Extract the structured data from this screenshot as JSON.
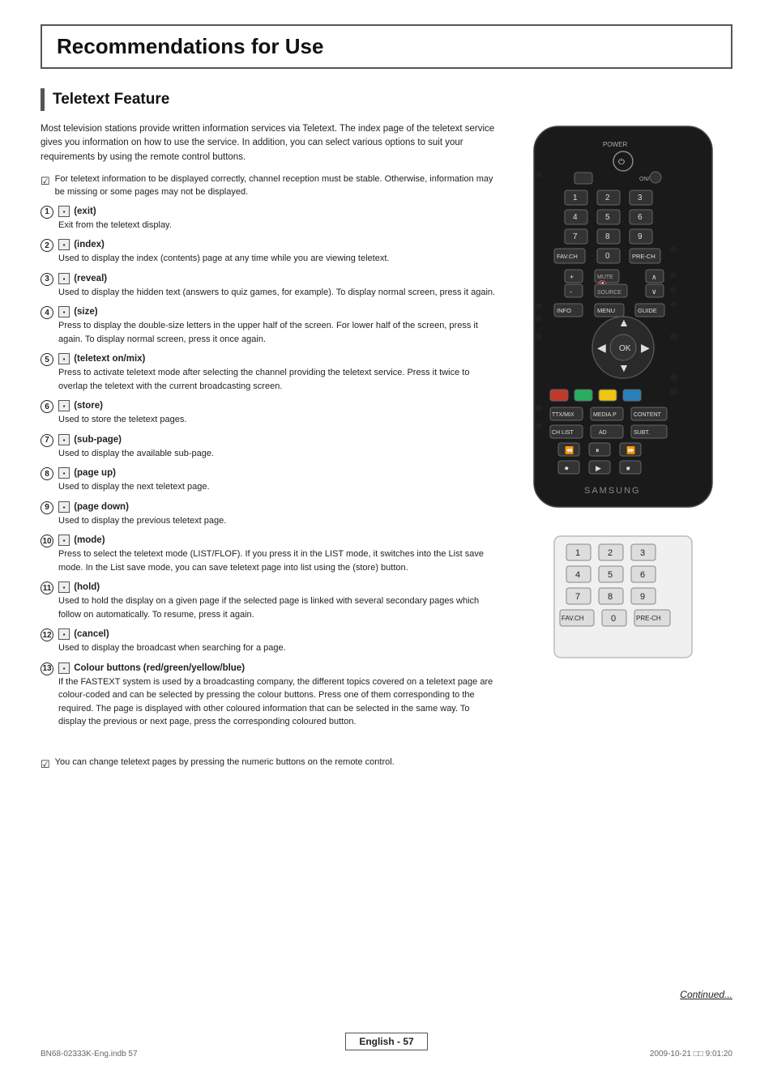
{
  "title": "Recommendations for Use",
  "section": {
    "heading": "Teletext Feature",
    "intro": "Most television stations provide written information services via Teletext. The index page of the teletext service gives you information on how to use the service. In addition, you can select various options to suit your requirements by using the remote control buttons.",
    "note1": "For teletext information to be displayed correctly, channel reception must be stable. Otherwise, information may be missing or some pages may not be displayed.",
    "features": [
      {
        "num": "1",
        "icon": "(exit)",
        "title": "(exit)",
        "desc": "Exit from the teletext display."
      },
      {
        "num": "2",
        "icon": "(index)",
        "title": "(index)",
        "desc": "Used to display the index (contents) page at any time while you are viewing teletext."
      },
      {
        "num": "3",
        "icon": "(reveal)",
        "title": "(reveal)",
        "desc": "Used to display the hidden text (answers to quiz games, for example). To display normal screen, press it again."
      },
      {
        "num": "4",
        "icon": "(size)",
        "title": "(size)",
        "desc": "Press to display the double-size letters in the upper half of the screen. For lower half of the screen, press it again. To display normal screen, press it once again."
      },
      {
        "num": "5",
        "icon": "(teletext on/mix)",
        "title": "(teletext on/mix)",
        "desc": "Press to activate teletext mode after selecting the channel providing the teletext service. Press it twice to overlap the teletext with the current broadcasting screen."
      },
      {
        "num": "6",
        "icon": "(store)",
        "title": "(store)",
        "desc": "Used to store the teletext pages."
      },
      {
        "num": "7",
        "icon": "(sub-page)",
        "title": "(sub-page)",
        "desc": "Used to display the available sub-page."
      },
      {
        "num": "8",
        "icon": "(page up)",
        "title": "(page up)",
        "desc": "Used to display the next teletext page."
      },
      {
        "num": "9",
        "icon": "(page down)",
        "title": "(page down)",
        "desc": "Used to display the previous teletext page."
      },
      {
        "num": "10",
        "icon": "(mode)",
        "title": "(mode)",
        "desc": "Press to select the teletext mode (LIST/FLOF). If you press it in the LIST mode, it switches into the List save mode. In the List save mode, you can save teletext page into list using the (store) button."
      },
      {
        "num": "11",
        "icon": "(hold)",
        "title": "(hold)",
        "desc": "Used to hold the display on a given page if the selected page is linked with several secondary pages which follow on automatically. To resume, press it again."
      },
      {
        "num": "12",
        "icon": "(cancel)",
        "title": "(cancel)",
        "desc": "Used to display the broadcast when searching for a page."
      },
      {
        "num": "13",
        "icon": "Colour buttons (red/green/yellow/blue)",
        "title": "Colour buttons (red/green/yellow/blue)",
        "desc": "If the FASTEXT system is used by a broadcasting company, the different topics covered on a teletext page are colour-coded and can be selected by pressing the colour buttons. Press one of them corresponding to the required. The page is displayed with other coloured information that can be selected in the same way. To display the previous or next page, press the corresponding coloured button."
      }
    ],
    "note2": "You can change teletext pages by pressing the numeric buttons on the remote control."
  },
  "footer": {
    "badge": "English - 57",
    "continued": "Continued...",
    "left_meta": "BN68-02333K-Eng.indb   57",
    "right_meta": "2009-10-21   □□ 9:01:20"
  }
}
